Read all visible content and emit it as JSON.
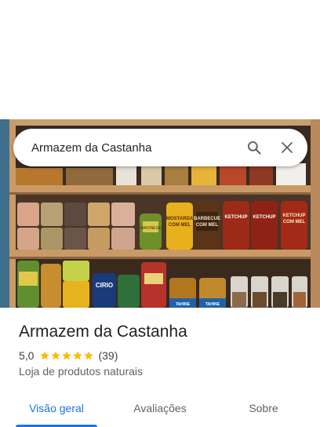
{
  "search": {
    "value": "Armazem da Castanha",
    "search_icon": "search-icon",
    "close_icon": "close-icon"
  },
  "photo": {
    "labels": {
      "mostarda": "MOSTARDA\nCOM MEL",
      "barbecue": "BARBECUE\nCOM MEL",
      "ketchup": "KETCHUP",
      "ketchup_mel": "KETCHUP\nCOM MEL",
      "maionese": "MAIONESE",
      "cirio": "CIRIO",
      "tahine": "TAHINE"
    }
  },
  "place": {
    "title": "Armazem da Castanha",
    "rating": "5,0",
    "stars": 5,
    "reviews": "(39)",
    "category": "Loja de produtos naturais"
  },
  "tabs": [
    {
      "label": "Visão geral",
      "active": true
    },
    {
      "label": "Avaliações",
      "active": false
    },
    {
      "label": "Sobre",
      "active": false
    }
  ],
  "colors": {
    "accent": "#1a73e8",
    "star": "#fbbc04",
    "text": "#202124",
    "muted": "#5f6368"
  }
}
